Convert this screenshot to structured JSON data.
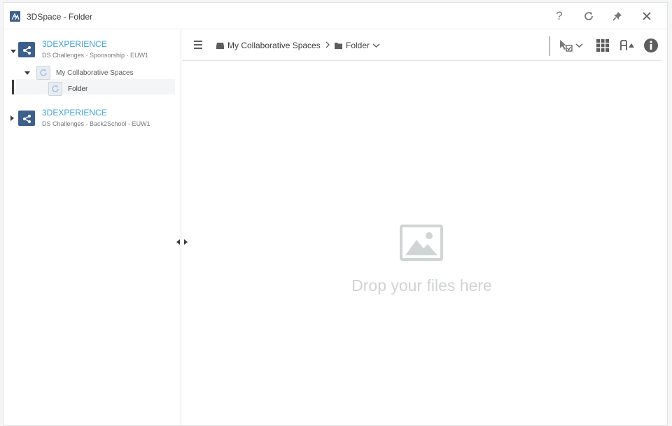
{
  "window": {
    "title": "3DSpace - Folder",
    "buttons": {
      "help": "?",
      "refresh": "refresh-icon",
      "pin": "pin-icon",
      "close": "close-icon"
    }
  },
  "tree": {
    "spaces": [
      {
        "name": "3DEXPERIENCE",
        "subtitle": "DS Challenges · Sponsorship · EUW1",
        "expanded": true,
        "children": [
          {
            "label": "My Collaborative Spaces",
            "expanded": true,
            "children": [
              {
                "label": "Folder",
                "selected": true
              }
            ]
          }
        ]
      },
      {
        "name": "3DEXPERIENCE",
        "subtitle": "DS Challenges - Back2School - EUW1",
        "expanded": false
      }
    ]
  },
  "toolbar": {
    "breadcrumb": [
      {
        "label": "My Collaborative Spaces",
        "icon": "collab-spaces-icon"
      },
      {
        "label": "Folder",
        "icon": "folder-icon",
        "has_dropdown": true
      }
    ]
  },
  "dropzone": {
    "text": "Drop your files here",
    "icon": "image-placeholder-icon"
  },
  "colors": {
    "accent": "#42a2da",
    "space_icon": "#3d5f8c",
    "text": "#3d3d3d",
    "muted": "#77797c",
    "placeholder": "#d1d4d4"
  }
}
